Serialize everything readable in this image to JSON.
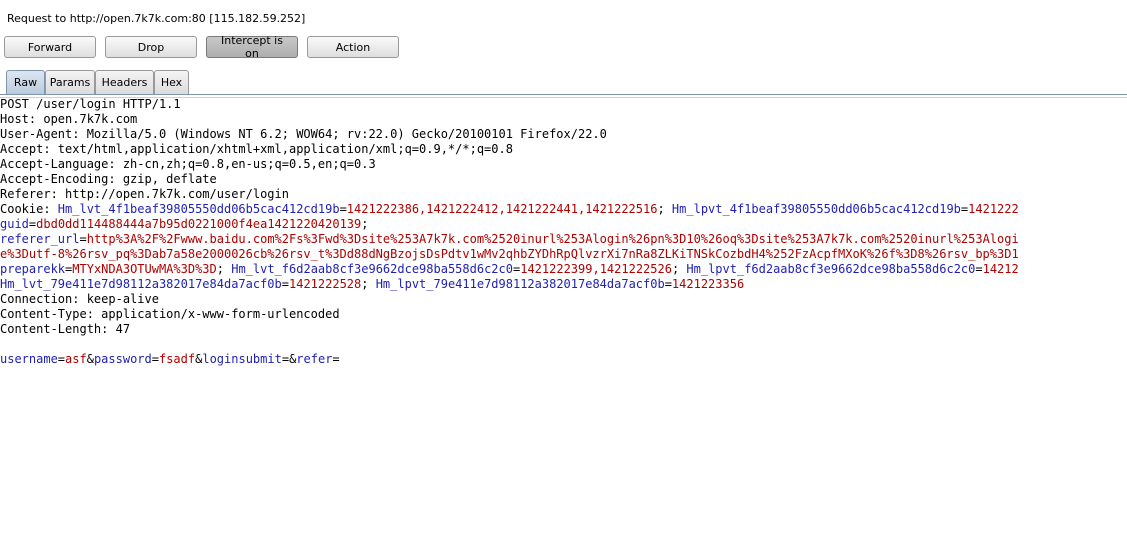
{
  "request_info": "Request to http://open.7k7k.com:80  [115.182.59.252]",
  "toolbar": {
    "forward_label": "Forward",
    "drop_label": "Drop",
    "intercept_label": "Intercept is on",
    "action_label": "Action"
  },
  "tabs": [
    "Raw",
    "Params",
    "Headers",
    "Hex"
  ],
  "request_lines": [
    [
      [
        "k",
        "POST /user/login HTTP/1.1"
      ]
    ],
    [
      [
        "k",
        "Host: open.7k7k.com"
      ]
    ],
    [
      [
        "k",
        "User-Agent: Mozilla/5.0 (Windows NT 6.2; WOW64; rv:22.0) Gecko/20100101 Firefox/22.0"
      ]
    ],
    [
      [
        "k",
        "Accept: text/html,application/xhtml+xml,application/xml;q=0.9,*/*;q=0.8"
      ]
    ],
    [
      [
        "k",
        "Accept-Language: zh-cn,zh;q=0.8,en-us;q=0.5,en;q=0.3"
      ]
    ],
    [
      [
        "k",
        "Accept-Encoding: gzip, deflate"
      ]
    ],
    [
      [
        "k",
        "Referer: http://open.7k7k.com/user/login"
      ]
    ],
    [
      [
        "k",
        "Cookie: "
      ],
      [
        "n",
        "Hm_lvt_4f1beaf39805550dd06b5cac412cd19b"
      ],
      [
        "p",
        "="
      ],
      [
        "v",
        "1421222386,1421222412,1421222441,1421222516"
      ],
      [
        "p",
        "; "
      ],
      [
        "n",
        "Hm_lpvt_4f1beaf39805550dd06b5cac412cd19b"
      ],
      [
        "p",
        "="
      ],
      [
        "v",
        "1421222"
      ]
    ],
    [
      [
        "n",
        "guid"
      ],
      [
        "p",
        "="
      ],
      [
        "v",
        "dbd0dd114488444a7b95d0221000f4ea1421220420139"
      ],
      [
        "p",
        ";"
      ]
    ],
    [
      [
        "n",
        "referer_url"
      ],
      [
        "p",
        "="
      ],
      [
        "v",
        "http%3A%2F%2Fwww.baidu.com%2Fs%3Fwd%3Dsite%253A7k7k.com%2520inurl%253Alogin%26pn%3D10%26oq%3Dsite%253A7k7k.com%2520inurl%253Alogi"
      ]
    ],
    [
      [
        "v",
        "e%3Dutf-8%26rsv_pq%3Dab7a58e2000026cb%26rsv_t%3Dd88dNgBzojsDsPdtv1wMv2qhbZYDhRpQlvzrXi7nRa8ZLKiTNSkCozbdH4%252FzAcpfMXoK%26f%3D8%26rsv_bp%3D1"
      ]
    ],
    [
      [
        "n",
        "preparekk"
      ],
      [
        "p",
        "="
      ],
      [
        "v",
        "MTYxNDA3OTUwMA%3D%3D"
      ],
      [
        "p",
        "; "
      ],
      [
        "n",
        "Hm_lvt_f6d2aab8cf3e9662dce98ba558d6c2c0"
      ],
      [
        "p",
        "="
      ],
      [
        "v",
        "1421222399,1421222526"
      ],
      [
        "p",
        "; "
      ],
      [
        "n",
        "Hm_lpvt_f6d2aab8cf3e9662dce98ba558d6c2c0"
      ],
      [
        "p",
        "="
      ],
      [
        "v",
        "14212"
      ]
    ],
    [
      [
        "n",
        "Hm_lvt_79e411e7d98112a382017e84da7acf0b"
      ],
      [
        "p",
        "="
      ],
      [
        "v",
        "1421222528"
      ],
      [
        "p",
        "; "
      ],
      [
        "n",
        "Hm_lpvt_79e411e7d98112a382017e84da7acf0b"
      ],
      [
        "p",
        "="
      ],
      [
        "v",
        "1421223356"
      ]
    ],
    [
      [
        "k",
        "Connection: keep-alive"
      ]
    ],
    [
      [
        "k",
        "Content-Type: application/x-www-form-urlencoded"
      ]
    ],
    [
      [
        "k",
        "Content-Length: 47"
      ]
    ],
    [],
    [
      [
        "n",
        "username"
      ],
      [
        "p",
        "="
      ],
      [
        "v",
        "asf"
      ],
      [
        "p",
        "&"
      ],
      [
        "n",
        "password"
      ],
      [
        "p",
        "="
      ],
      [
        "v",
        "fsadf"
      ],
      [
        "p",
        "&"
      ],
      [
        "n",
        "loginsubmit"
      ],
      [
        "p",
        "="
      ],
      [
        "p",
        "&"
      ],
      [
        "n",
        "refer"
      ],
      [
        "p",
        "="
      ]
    ]
  ]
}
